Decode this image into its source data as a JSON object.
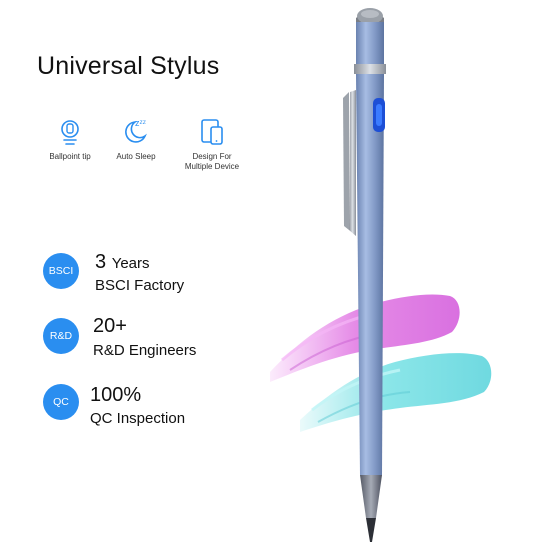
{
  "title": "Universal Stylus",
  "features": [
    {
      "icon": "ballpoint-tip-icon",
      "label": "Ballpoint tip"
    },
    {
      "icon": "auto-sleep-icon",
      "label": "Auto Sleep",
      "glyph": "zᶻᶻ"
    },
    {
      "icon": "multiple-device-icon",
      "label_line1": "Design For",
      "label_line2": "Multiple Device"
    }
  ],
  "stats": [
    {
      "badge": "BSCI",
      "number": "3",
      "unit": "Years",
      "desc": "BSCI Factory"
    },
    {
      "badge": "R&D",
      "number": "20+",
      "desc": "R&D Engineers"
    },
    {
      "badge": "QC",
      "number": "100%",
      "desc": "QC Inspection"
    }
  ],
  "colors": {
    "accent_blue": "#2a8ef0",
    "pen_body": "#7f97c4",
    "brush_pink": "#e880ea",
    "brush_cyan": "#78e0e4"
  }
}
